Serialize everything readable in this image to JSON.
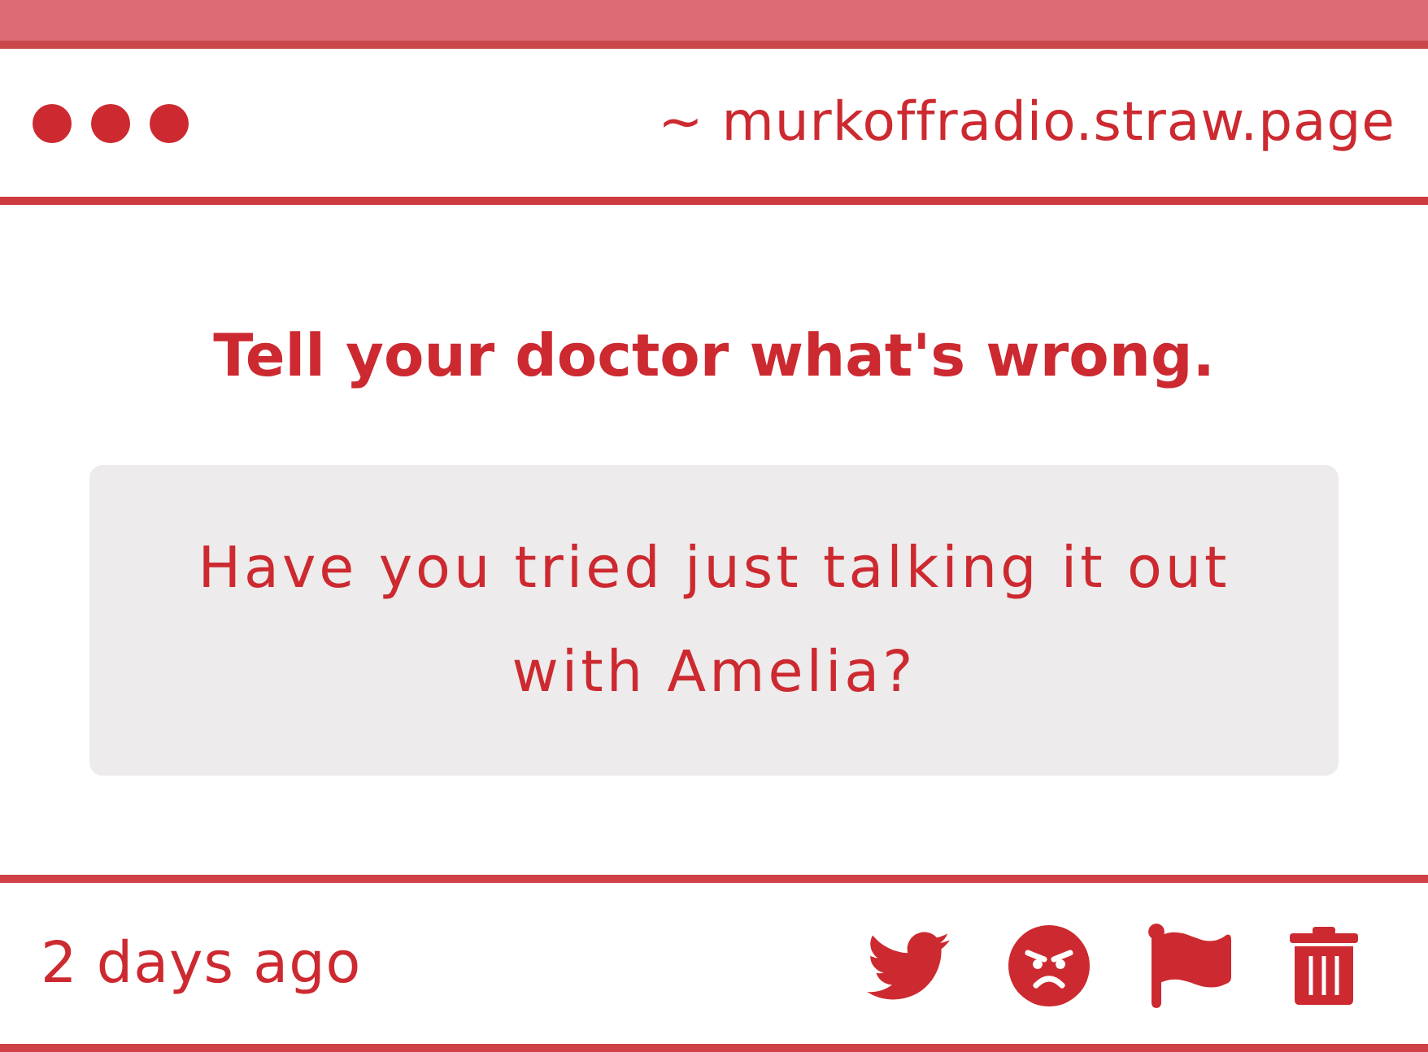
{
  "window": {
    "url": "~ murkoffradio.straw.page"
  },
  "post": {
    "title": "Tell your doctor what's wrong.",
    "message": "Have you tried just talking it out with Amelia?"
  },
  "footer": {
    "time": "2 days ago"
  }
}
